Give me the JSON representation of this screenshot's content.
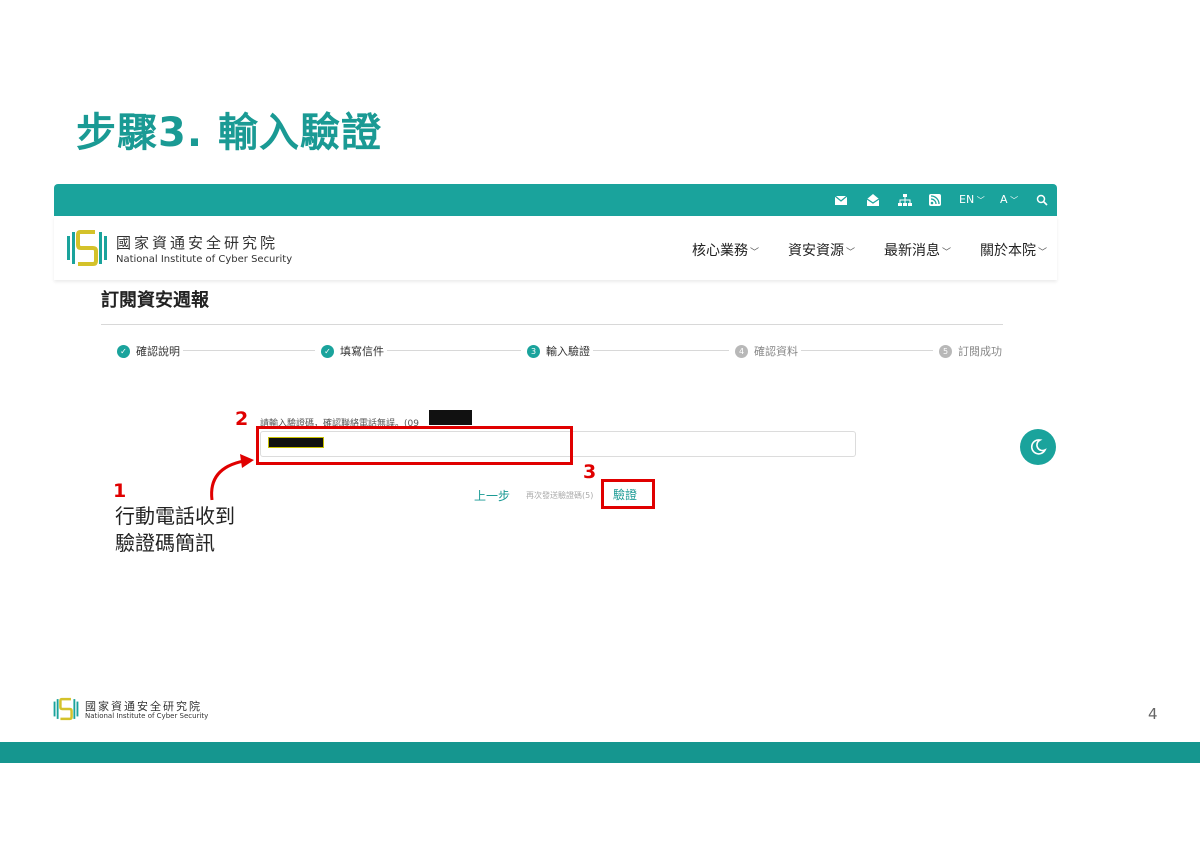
{
  "slide": {
    "title": "步驟3. 輸入驗證",
    "page_number": "4",
    "footer_org_zh": "國家資通安全研究院",
    "footer_org_en": "National Institute of Cyber Security"
  },
  "utility_bar": {
    "icons": [
      "mail-icon",
      "mail-open-icon",
      "sitemap-icon",
      "rss-icon",
      "search-icon"
    ],
    "lang_label": "EN",
    "font_size_label": "A"
  },
  "header": {
    "org_zh": "國家資通安全研究院",
    "org_en": "National Institute of Cyber Security",
    "nav": [
      "核心業務",
      "資安資源",
      "最新消息",
      "關於本院"
    ]
  },
  "page": {
    "heading": "訂閱資安週報",
    "steps": [
      {
        "label": "確認說明",
        "state": "done",
        "marker": "✓"
      },
      {
        "label": "填寫信件",
        "state": "done",
        "marker": "✓"
      },
      {
        "label": "輸入驗證",
        "state": "current",
        "marker": "3"
      },
      {
        "label": "確認資料",
        "state": "todo",
        "marker": "4"
      },
      {
        "label": "訂閱成功",
        "state": "todo",
        "marker": "5"
      }
    ],
    "prompt": "請輸入驗證碼，確認聯絡電話無誤。(09",
    "prev_button": "上一步",
    "resend_label": "再次發送驗證碼(5)",
    "verify_button": "驗證"
  },
  "annotations": {
    "label_1": "1",
    "label_2": "2",
    "label_3": "3",
    "note_line1": "行動電話收到",
    "note_line2": "驗證碼簡訊"
  },
  "colors": {
    "brand_teal": "#1aa39c",
    "title_teal": "#1a9a94",
    "annotation_red": "#e00000",
    "logo_yellow": "#d4c22a"
  }
}
